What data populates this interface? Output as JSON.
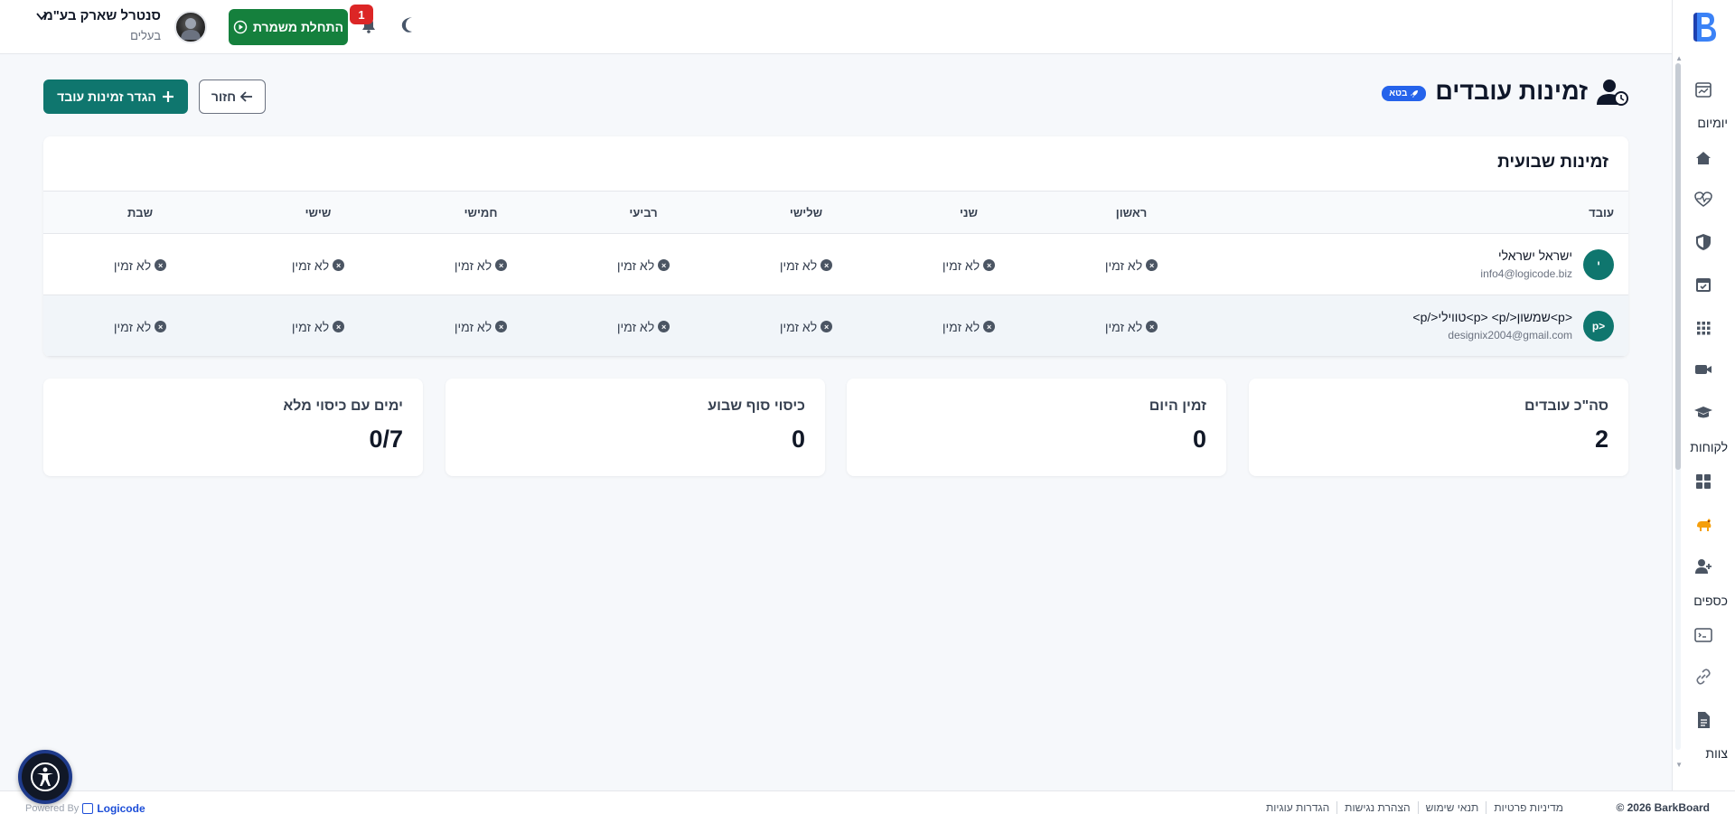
{
  "header": {
    "company_name": "סנטרל שארק בע\"מ",
    "company_role": "בעלים",
    "shift_button": "התחלת משמרת",
    "notification_count": "1"
  },
  "sidebar": {
    "labels": [
      "יומיום",
      "לקוחות",
      "כספים",
      "צוות"
    ]
  },
  "page": {
    "title": "זמינות עובדים",
    "beta": "בטא",
    "back_button": "חזור",
    "define_button": "הגדר זמינות עובד"
  },
  "weekly": {
    "title": "זמינות שבועית",
    "columns": [
      "עובד",
      "ראשון",
      "שני",
      "שלישי",
      "רביעי",
      "חמישי",
      "שישי",
      "שבת"
    ],
    "no_time": "לא זמין",
    "employees": [
      {
        "initial": "י",
        "name": "ישראל ישראלי",
        "email": "info4@logicode.biz"
      },
      {
        "initial": "<p",
        "name": "<p>שמשון</p> <p>טווילי</p>",
        "email": "designix2004@gmail.com"
      }
    ]
  },
  "stats": [
    {
      "label": "סה\"כ עובדים",
      "value": "2"
    },
    {
      "label": "זמין היום",
      "value": "0"
    },
    {
      "label": "כיסוי סוף שבוע",
      "value": "0"
    },
    {
      "label": "ימים עם כיסוי מלא",
      "value": "0/7"
    }
  ],
  "footer": {
    "copyright": "© 2026 BarkBoard",
    "links": [
      "מדיניות פרטיות",
      "תנאי שימוש",
      "הצהרת נגישות",
      "הגדרות עוגיות"
    ],
    "powered_by": "Powered By",
    "powered_brand": "Logicode"
  },
  "colors": {
    "primary_teal": "#0f766e",
    "shift_green": "#15803d",
    "beta_blue": "#2563eb",
    "badge_red": "#dc2626"
  }
}
